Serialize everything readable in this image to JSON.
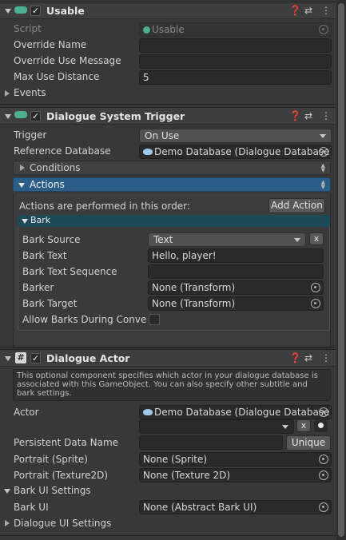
{
  "usable": {
    "title": "Usable",
    "script_label": "Script",
    "script_value": "Usable",
    "override_name_label": "Override Name",
    "override_name_value": "",
    "override_use_message_label": "Override Use Message",
    "override_use_message_value": "",
    "max_use_distance_label": "Max Use Distance",
    "max_use_distance_value": "5",
    "events_label": "Events"
  },
  "trigger": {
    "title": "Dialogue System Trigger",
    "trigger_label": "Trigger",
    "trigger_value": "On Use",
    "reference_db_label": "Reference Database",
    "reference_db_value": "Demo Database (Dialogue Database)",
    "conditions_label": "Conditions",
    "actions_label": "Actions",
    "actions_order_text": "Actions are performed in this order:",
    "add_action_label": "Add Action",
    "bark_header": "Bark",
    "bark_source_label": "Bark Source",
    "bark_source_value": "Text",
    "remove_label": "x",
    "bark_text_label": "Bark Text",
    "bark_text_value": "Hello, player!",
    "bark_text_sequence_label": "Bark Text Sequence",
    "bark_text_sequence_value": "",
    "barker_label": "Barker",
    "barker_value": "None (Transform)",
    "bark_target_label": "Bark Target",
    "bark_target_value": "None (Transform)",
    "allow_barks_label": "Allow Barks During Convers"
  },
  "actor": {
    "title": "Dialogue Actor",
    "help_text": "This optional component specifies which actor in your dialogue database is associated with this GameObject. You can also specify other subtitle and bark settings.",
    "actor_label": "Actor",
    "actor_db_value": "Demo Database (Dialogue Database)",
    "actor_select_value": "",
    "clear_label": "x",
    "persistent_label": "Persistent Data Name",
    "persistent_value": "",
    "unique_label": "Unique",
    "portrait_sprite_label": "Portrait (Sprite)",
    "portrait_sprite_value": "None (Sprite)",
    "portrait_tex_label": "Portrait (Texture2D)",
    "portrait_tex_value": "None (Texture 2D)",
    "bark_ui_settings_label": "Bark UI Settings",
    "bark_ui_label": "Bark UI",
    "bark_ui_value": "None (Abstract Bark UI)",
    "dialogue_ui_settings_label": "Dialogue UI Settings"
  },
  "colors": {
    "accent": "#2c5d87",
    "component_icon": "#4caf92"
  }
}
